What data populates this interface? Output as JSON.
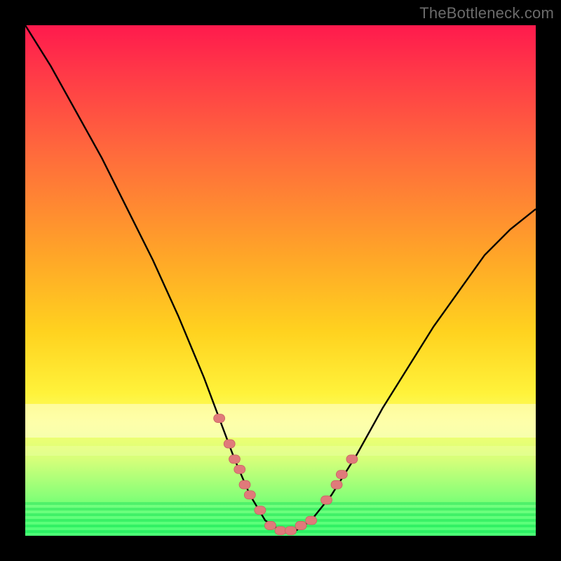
{
  "watermark": "TheBottleneck.com",
  "colors": {
    "curve": "#000000",
    "marker": "#e07a7a",
    "marker_stroke": "#c96262"
  },
  "chart_data": {
    "type": "line",
    "title": "",
    "xlabel": "",
    "ylabel": "",
    "xlim": [
      0,
      100
    ],
    "ylim": [
      0,
      100
    ],
    "grid": false,
    "legend": false,
    "series": [
      {
        "name": "bottleneck-curve",
        "x": [
          0,
          5,
          10,
          15,
          20,
          25,
          30,
          35,
          38,
          41,
          44,
          47,
          50,
          53,
          56,
          60,
          65,
          70,
          75,
          80,
          85,
          90,
          95,
          100
        ],
        "values": [
          100,
          92,
          83,
          74,
          64,
          54,
          43,
          31,
          23,
          15,
          8,
          3,
          1,
          1,
          3,
          8,
          16,
          25,
          33,
          41,
          48,
          55,
          60,
          64
        ]
      }
    ],
    "markers": {
      "name": "highlight-dots",
      "x": [
        38,
        40,
        41,
        42,
        43,
        44,
        46,
        48,
        50,
        52,
        54,
        56,
        59,
        61,
        62,
        64
      ],
      "values": [
        23,
        18,
        15,
        13,
        10,
        8,
        5,
        2,
        1,
        1,
        2,
        3,
        7,
        10,
        12,
        15
      ]
    }
  }
}
